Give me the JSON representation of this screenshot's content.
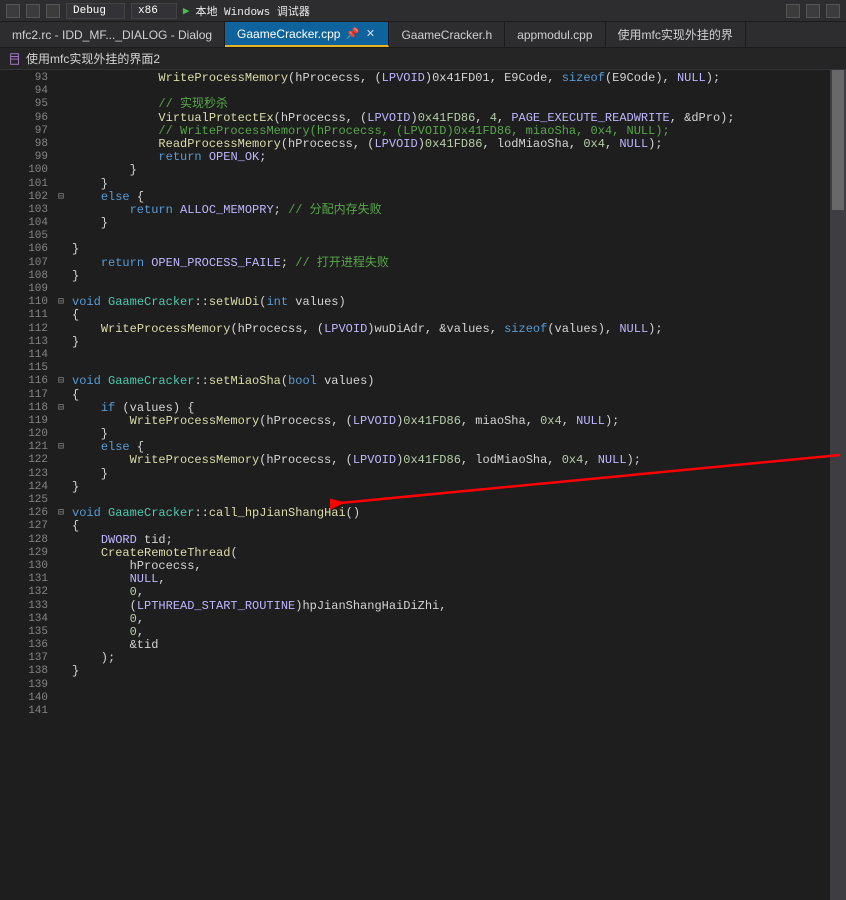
{
  "toolbar": {
    "config_label": "Debug",
    "platform_label": "x86",
    "run_label": "本地 Windows 调试器"
  },
  "tabs": [
    {
      "label": "mfc2.rc - IDD_MF..._DIALOG - Dialog",
      "active": false
    },
    {
      "label": "GaameCracker.cpp",
      "active": true
    },
    {
      "label": "GaameCracker.h",
      "active": false
    },
    {
      "label": "appmodul.cpp",
      "active": false
    },
    {
      "label": "使用mfc实现外挂的界",
      "active": false
    }
  ],
  "breadcrumb": "使用mfc实现外挂的界面2",
  "gutter_start": 93,
  "gutter_end": 141,
  "code_lines": [
    {
      "n": 93,
      "html": "            <span class='fn'>WriteProcessMemory</span>(hProcecss, (<span class='mac'>LPVOID</span>)0x41FD01, E9Code, <span class='kw'>sizeof</span>(E9Code), <span class='mac'>NULL</span>);"
    },
    {
      "n": 94,
      "html": ""
    },
    {
      "n": 95,
      "html": "            <span class='cmt'>// 实现秒杀</span>"
    },
    {
      "n": 96,
      "html": "            <span class='fn'>VirtualProtectEx</span>(hProcecss, (<span class='mac'>LPVOID</span>)<span class='num'>0x41FD86</span>, <span class='num'>4</span>, <span class='mac'>PAGE_EXECUTE_READWRITE</span>, &amp;dPro);"
    },
    {
      "n": 97,
      "html": "            <span class='cmt'>// WriteProcessMemory(hProcecss, (LPVOID)0x41FD86, miaoSha, 0x4, NULL);</span>"
    },
    {
      "n": 98,
      "html": "            <span class='fn'>ReadProcessMemory</span>(hProcecss, (<span class='mac'>LPVOID</span>)<span class='num'>0x41FD86</span>, lodMiaoSha, <span class='num'>0x4</span>, <span class='mac'>NULL</span>);"
    },
    {
      "n": 99,
      "html": "            <span class='kw'>return</span> <span class='mac'>OPEN_OK</span>;"
    },
    {
      "n": 100,
      "html": "        }"
    },
    {
      "n": 101,
      "html": "    }"
    },
    {
      "n": 102,
      "html": "    <span class='kw'>else</span> {"
    },
    {
      "n": 103,
      "html": "        <span class='kw'>return</span> <span class='mac'>ALLOC_MEMOPRY</span>; <span class='cmt'>// 分配内存失败</span>"
    },
    {
      "n": 104,
      "html": "    }"
    },
    {
      "n": 105,
      "html": ""
    },
    {
      "n": 106,
      "html": "}"
    },
    {
      "n": 107,
      "html": "    <span class='kw'>return</span> <span class='mac'>OPEN_PROCESS_FAILE</span>; <span class='cmt'>// 打开进程失败</span>"
    },
    {
      "n": 108,
      "html": "}"
    },
    {
      "n": 109,
      "html": ""
    },
    {
      "n": 110,
      "html": "<span class='kw'>void</span> <span class='type'>GaameCracker</span>::<span class='fn'>setWuDi</span>(<span class='kw'>int</span> values)"
    },
    {
      "n": 111,
      "html": "{"
    },
    {
      "n": 112,
      "html": "    <span class='fn'>WriteProcessMemory</span>(hProcecss, (<span class='mac'>LPVOID</span>)wuDiAdr, &amp;values, <span class='kw'>sizeof</span>(values), <span class='mac'>NULL</span>);"
    },
    {
      "n": 113,
      "html": "}"
    },
    {
      "n": 114,
      "html": ""
    },
    {
      "n": 115,
      "html": ""
    },
    {
      "n": 116,
      "html": "<span class='kw'>void</span> <span class='type'>GaameCracker</span>::<span class='fn'>setMiaoSha</span>(<span class='kw'>bool</span> values)"
    },
    {
      "n": 117,
      "html": "{"
    },
    {
      "n": 118,
      "html": "    <span class='kw'>if</span> (values) {"
    },
    {
      "n": 119,
      "html": "        <span class='fn'>WriteProcessMemory</span>(hProcecss, (<span class='mac'>LPVOID</span>)<span class='num'>0x41FD86</span>, miaoSha, <span class='num'>0x4</span>, <span class='mac'>NULL</span>);"
    },
    {
      "n": 120,
      "html": "    }"
    },
    {
      "n": 121,
      "html": "    <span class='kw'>else</span> {"
    },
    {
      "n": 122,
      "html": "        <span class='fn'>WriteProcessMemory</span>(hProcecss, (<span class='mac'>LPVOID</span>)<span class='num'>0x41FD86</span>, lodMiaoSha, <span class='num'>0x4</span>, <span class='mac'>NULL</span>);"
    },
    {
      "n": 123,
      "html": "    }"
    },
    {
      "n": 124,
      "html": "}"
    },
    {
      "n": 125,
      "html": ""
    },
    {
      "n": 126,
      "html": "<span class='kw'>void</span> <span class='type'>GaameCracker</span>::<span class='fn'>call_hpJianShangHai</span>()"
    },
    {
      "n": 127,
      "html": "{"
    },
    {
      "n": 128,
      "html": "    <span class='mac'>DWORD</span> tid;"
    },
    {
      "n": 129,
      "html": "    <span class='fn'>CreateRemoteThread</span>("
    },
    {
      "n": 130,
      "html": "        hProcecss,"
    },
    {
      "n": 131,
      "html": "        <span class='mac'>NULL</span>,"
    },
    {
      "n": 132,
      "html": "        <span class='num'>0</span>,"
    },
    {
      "n": 133,
      "html": "        (<span class='mac'>LPTHREAD_START_ROUTINE</span>)hpJianShangHaiDiZhi,"
    },
    {
      "n": 134,
      "html": "        <span class='num'>0</span>,"
    },
    {
      "n": 135,
      "html": "        <span class='num'>0</span>,"
    },
    {
      "n": 136,
      "html": "        &amp;tid"
    },
    {
      "n": 137,
      "html": "    );"
    },
    {
      "n": 138,
      "html": "}"
    },
    {
      "n": 139,
      "html": ""
    },
    {
      "n": 140,
      "html": ""
    },
    {
      "n": 141,
      "html": ""
    }
  ],
  "fold_marks": {
    "102": "⊟",
    "110": "⊟",
    "116": "⊟",
    "118": "⊟",
    "121": "⊟",
    "126": "⊟"
  },
  "arrow_color": "#ff0000"
}
